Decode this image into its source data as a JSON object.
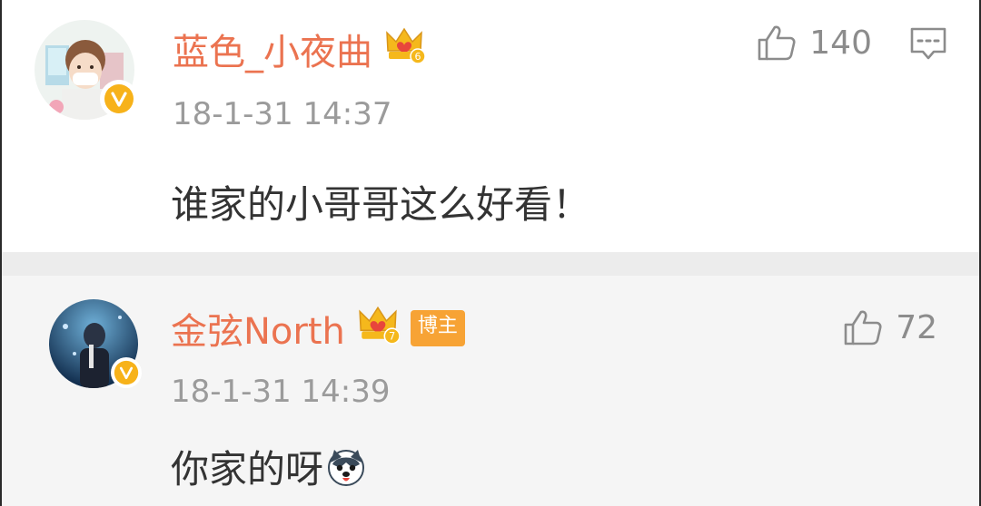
{
  "comments": [
    {
      "username": "蓝色_小夜曲",
      "crown_level": "6",
      "timestamp": "18-1-31 14:37",
      "text": "谁家的小哥哥这么好看！",
      "likes": "140",
      "icons": [
        "like-thumb-icon",
        "reply-comment-icon",
        "crown-icon",
        "verified-v-icon"
      ]
    },
    {
      "username": "金弦North",
      "crown_level": "7",
      "badge": "博主",
      "timestamp": "18-1-31 14:39",
      "text": "你家的呀",
      "likes": "72",
      "icons": [
        "like-thumb-icon",
        "crown-icon",
        "verified-v-icon",
        "husky-emoji-icon"
      ]
    }
  ],
  "colors": {
    "username": "#eb7350",
    "timestamp": "#9b9b9b",
    "body_text": "#333333",
    "icon_gray": "#8c8c8c",
    "badge_bg": "#f7a335",
    "crown_gold": "#f5b81c",
    "crown_red": "#e8453c",
    "separator": "#ececec",
    "reply_bg": "#f5f5f5"
  }
}
